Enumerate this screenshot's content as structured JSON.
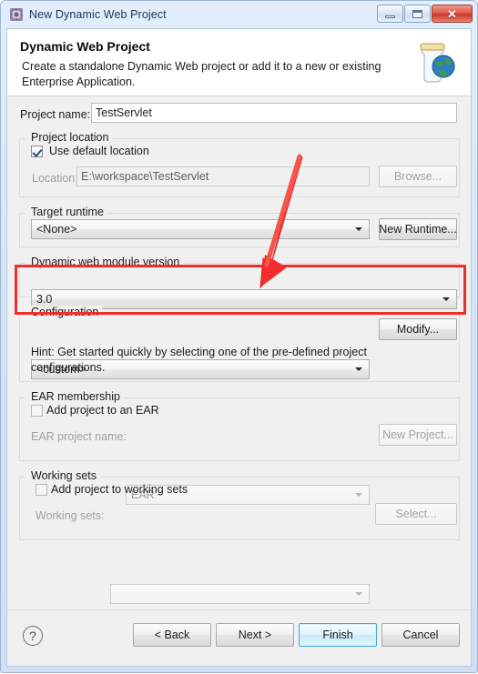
{
  "window": {
    "title": "New Dynamic Web Project",
    "icon": "eclipse-project-icon",
    "buttons": {
      "minimize": "minimize-icon",
      "maximize": "maximize-icon",
      "close": "✕"
    }
  },
  "header": {
    "title": "Dynamic Web Project",
    "description": "Create a standalone Dynamic Web project or add it to a new or existing Enterprise Application.",
    "icon": "web-project-jar-globe-icon"
  },
  "project_name": {
    "label": "Project name:",
    "value": "TestServlet",
    "placeholder": ""
  },
  "project_location": {
    "group_title": "Project location",
    "use_default_label": "Use default location",
    "use_default_checked": true,
    "location_label": "Location:",
    "location_value": "E:\\workspace\\TestServlet",
    "browse_label": "Browse..."
  },
  "target_runtime": {
    "group_title": "Target runtime",
    "value": "<None>",
    "new_runtime_label": "New Runtime..."
  },
  "dynamic_web_module_version": {
    "group_title": "Dynamic web module version",
    "value": "3.0"
  },
  "configuration": {
    "group_title": "Configuration",
    "value": "<custom>",
    "modify_label": "Modify...",
    "hint": "Hint: Get started quickly by selecting one of the pre-defined project configurations."
  },
  "ear_membership": {
    "group_title": "EAR membership",
    "add_label": "Add project to an EAR",
    "add_checked": false,
    "project_name_label": "EAR project name:",
    "project_name_value": "EAR",
    "new_project_label": "New Project..."
  },
  "working_sets": {
    "group_title": "Working sets",
    "add_label": "Add project to working sets",
    "add_checked": false,
    "sets_label": "Working sets:",
    "sets_value": "",
    "select_label": "Select..."
  },
  "footer": {
    "help": "?",
    "back_label": "< Back",
    "next_label": "Next >",
    "finish_label": "Finish",
    "cancel_label": "Cancel"
  },
  "annotation": {
    "highlight_color": "#f22d2d",
    "arrow_color": "#f22d2d",
    "target": "dynamic-web-module-version"
  }
}
